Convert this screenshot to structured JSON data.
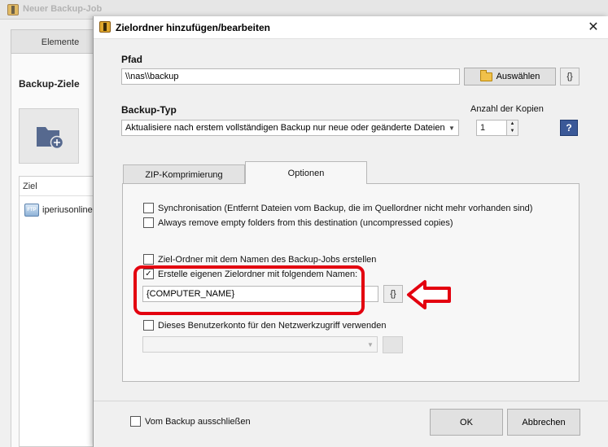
{
  "background_window": {
    "title": "Neuer Backup-Job",
    "tab_label": "Elemente",
    "section_heading": "Backup-Ziele",
    "list_header": "Ziel",
    "list_items": [
      "iperiusonline"
    ]
  },
  "dialog": {
    "title": "Zielordner hinzufügen/bearbeiten",
    "path_label": "Pfad",
    "path_value": "\\\\nas\\\\backup",
    "choose_button": "Auswählen",
    "variables_button": "{}",
    "backup_type_label": "Backup-Typ",
    "backup_type_value": "Aktualisiere nach erstem vollständigen Backup nur neue oder geänderte Dateien",
    "copies_label": "Anzahl der Kopien",
    "copies_value": "1",
    "help_button": "?",
    "tabs": [
      {
        "label": "ZIP-Komprimierung",
        "active": false
      },
      {
        "label": "Optionen",
        "active": true
      }
    ],
    "options": {
      "sync_label": "Synchronisation  (Entfernt Dateien vom Backup, die im Quellordner nicht mehr vorhanden sind)",
      "sync_checked": false,
      "remove_empty_label": "Always remove empty folders from this destination (uncompressed copies)",
      "remove_empty_checked": false,
      "job_name_folder_label": "Ziel-Ordner mit dem Namen des Backup-Jobs erstellen",
      "job_name_folder_checked": false,
      "custom_folder_label": "Erstelle eigenen Zielordner mit folgendem Namen:",
      "custom_folder_checked": true,
      "custom_folder_value": "{COMPUTER_NAME}",
      "custom_folder_var_button": "{}",
      "network_account_label": "Dieses Benutzerkonto für den Netzwerkzugriff verwenden",
      "network_account_checked": false,
      "network_account_value": ""
    },
    "exclude_label": "Vom Backup ausschließen",
    "exclude_checked": false,
    "ok_button": "OK",
    "cancel_button": "Abbrechen"
  },
  "annotation": {
    "highlight_color": "#e3000f",
    "arrow_direction": "left"
  }
}
